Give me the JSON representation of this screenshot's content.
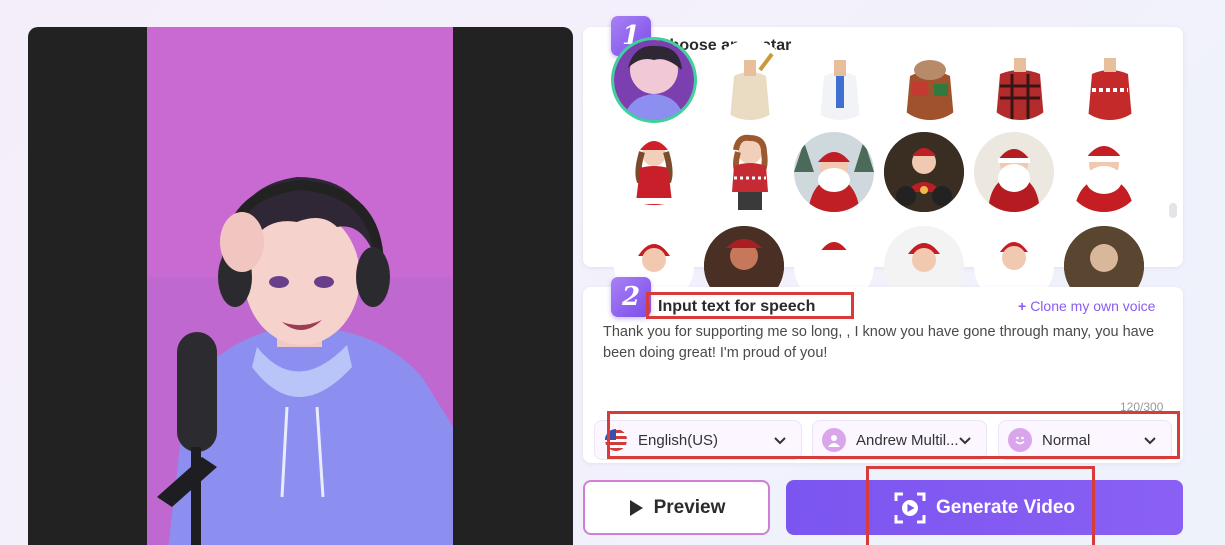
{
  "steps": {
    "one": {
      "number": "1",
      "title": "Choose an avatar"
    },
    "two": {
      "number": "2",
      "title": "Input text for speech"
    }
  },
  "avatars": [
    {
      "description": "anime-boy-selected"
    },
    {
      "description": "man-cream-shirt"
    },
    {
      "description": "man-white-shirt"
    },
    {
      "description": "bearded-man-gifts"
    },
    {
      "description": "man-plaid-shirt"
    },
    {
      "description": "man-christmas-sweater"
    },
    {
      "description": "girl-santa-dress"
    },
    {
      "description": "girl-christmas-sweater"
    },
    {
      "description": "santa-snow-forest"
    },
    {
      "description": "santa-motorbike"
    },
    {
      "description": "santa-red-suit"
    },
    {
      "description": "santa-smiling"
    }
  ],
  "speech": {
    "clone_label": "Clone my own voice",
    "text": "Thank you for supporting me so long, , I know you have gone through many, you have been doing great! I'm proud of you!",
    "char_count": "120/300"
  },
  "options": {
    "language": "English(US)",
    "voice": "Andrew Multil...",
    "mood": "Normal"
  },
  "buttons": {
    "preview": "Preview",
    "generate": "Generate Video"
  },
  "colors": {
    "accent": "#8a5cf0",
    "highlight": "#d93a3a",
    "selected_ring": "#3fd19b"
  }
}
